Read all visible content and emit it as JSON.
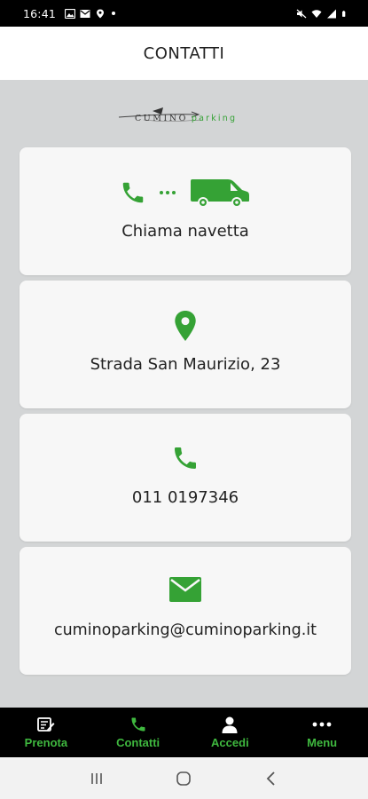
{
  "status_bar": {
    "time": "16:41"
  },
  "header": {
    "title": "CONTATTI"
  },
  "logo": {
    "text_main": "CUMINO",
    "text_accent": "parking"
  },
  "cards": [
    {
      "label": "Chiama navetta",
      "icon": "phone-van-icon"
    },
    {
      "label": "Strada San Maurizio, 23",
      "icon": "location-pin-icon"
    },
    {
      "label": "011 0197346",
      "icon": "phone-icon"
    },
    {
      "label": "cuminoparking@cuminoparking.it",
      "icon": "envelope-icon"
    }
  ],
  "bottom_nav": {
    "items": [
      {
        "label": "Prenota",
        "icon": "calendar-edit-icon"
      },
      {
        "label": "Contatti",
        "icon": "phone-icon"
      },
      {
        "label": "Accedi",
        "icon": "user-icon"
      },
      {
        "label": "Menu",
        "icon": "more-dots-icon"
      }
    ]
  },
  "colors": {
    "accent": "#35a235",
    "nav_label": "#3fb83f",
    "background": "#d3d5d6",
    "card": "#f7f7f7"
  }
}
